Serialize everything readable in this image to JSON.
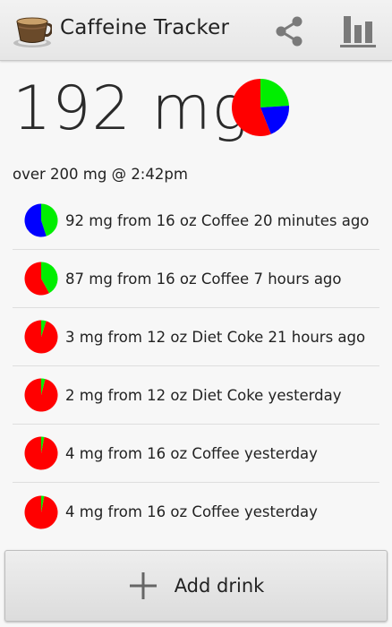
{
  "app": {
    "title": "Caffeine Tracker"
  },
  "toolbar": {
    "share_icon": "share-icon",
    "stats_icon": "bar-chart-icon"
  },
  "summary": {
    "total": "192 mg",
    "projection": "over 200 mg @ 2:42pm",
    "pie_fraction": 0.56,
    "pie_colors": {
      "primary": "#ff0000",
      "secondary": "#00ee00",
      "tertiary": "#0000ff"
    }
  },
  "drinks": [
    {
      "text": "92 mg from 16 oz Coffee 20 minutes ago",
      "pie": {
        "blue": 0.55,
        "green": 0.45,
        "red": 0
      }
    },
    {
      "text": "87 mg from 16 oz Coffee 7 hours ago",
      "pie": {
        "blue": 0,
        "green": 0.42,
        "red": 0.58
      }
    },
    {
      "text": "3 mg from 12 oz Diet Coke 21 hours ago",
      "pie": {
        "blue": 0,
        "green": 0.05,
        "red": 0.95
      }
    },
    {
      "text": "2 mg from 12 oz Diet Coke yesterday",
      "pie": {
        "blue": 0,
        "green": 0.04,
        "red": 0.96
      }
    },
    {
      "text": "4 mg from 16 oz Coffee yesterday",
      "pie": {
        "blue": 0,
        "green": 0.03,
        "red": 0.97
      }
    },
    {
      "text": "4 mg from 16 oz Coffee yesterday",
      "pie": {
        "blue": 0,
        "green": 0.03,
        "red": 0.97
      }
    }
  ],
  "add_button": {
    "label": "Add drink",
    "icon": "plus-icon"
  }
}
